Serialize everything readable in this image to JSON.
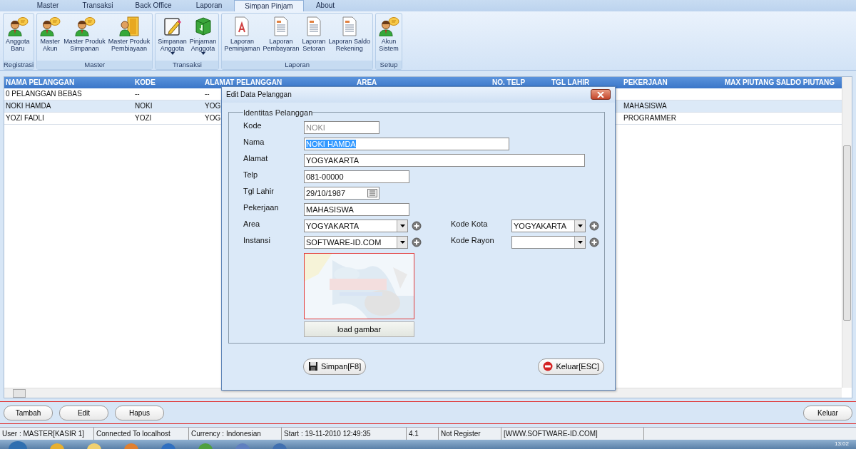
{
  "tabs": [
    {
      "label": "Master",
      "selected": false
    },
    {
      "label": "Transaksi",
      "selected": false
    },
    {
      "label": "Back Office",
      "selected": false
    },
    {
      "label": "Laporan",
      "selected": false
    },
    {
      "label": "Simpan Pinjam",
      "selected": true
    },
    {
      "label": "About",
      "selected": false
    }
  ],
  "ribbon": {
    "groups": [
      {
        "label": "Registrasi",
        "items": [
          {
            "lines": [
              "Anggota",
              "Baru"
            ],
            "dropdown": false
          }
        ]
      },
      {
        "label": "Master",
        "items": [
          {
            "lines": [
              "Master",
              "Akun"
            ],
            "dropdown": false
          },
          {
            "lines": [
              "Master Produk",
              "Simpanan"
            ],
            "dropdown": false
          },
          {
            "lines": [
              "Master Produk",
              "Pembiayaan"
            ],
            "dropdown": false
          }
        ]
      },
      {
        "label": "Transaksi",
        "items": [
          {
            "lines": [
              "Simpanan",
              "Anggota"
            ],
            "dropdown": true
          },
          {
            "lines": [
              "Pinjaman",
              "Anggota"
            ],
            "dropdown": true
          }
        ]
      },
      {
        "label": "Laporan",
        "items": [
          {
            "lines": [
              "Laporan",
              "Peminjaman"
            ],
            "dropdown": false
          },
          {
            "lines": [
              "Laporan",
              "Pembayaran"
            ],
            "dropdown": false
          },
          {
            "lines": [
              "Laporan",
              "Setoran"
            ],
            "dropdown": false
          },
          {
            "lines": [
              "Laporan Saldo",
              "Rekening"
            ],
            "dropdown": false
          }
        ]
      },
      {
        "label": "Setup",
        "items": [
          {
            "lines": [
              "Akun",
              "Sistem"
            ],
            "dropdown": false
          }
        ]
      }
    ]
  },
  "table": {
    "columns": [
      "NAMA PELANGGAN",
      "KODE",
      "ALAMAT PELANGGAN",
      "AREA",
      "NO. TELP",
      "TGL LAHIR",
      "PEKERJAAN",
      "MAX PIUTANG SALDO PIUTANG"
    ],
    "rows": [
      {
        "nama": "0 PELANGGAN BEBAS",
        "kode": "--",
        "alamat": "--",
        "selected": false
      },
      {
        "nama": "NOKI HAMDA",
        "kode": "NOKI",
        "alamat": "YOG",
        "pekerjaan": "MAHASISWA",
        "selected": true
      },
      {
        "nama": "YOZI FADLI",
        "kode": "YOZI",
        "alamat": "YOG",
        "pekerjaan": "PROGRAMMER",
        "selected": false
      }
    ]
  },
  "dialog": {
    "title": "Edit Data Pelanggan",
    "group_label": "Identitas Pelanggan",
    "rows": [
      [
        {
          "label": "Kode",
          "kind": "text",
          "value": "NOKI",
          "disabled": true
        }
      ],
      [
        {
          "label": "Nama",
          "kind": "text",
          "value": "NOKI HAMDA",
          "highlighted": true
        }
      ],
      [
        {
          "label": "Alamat",
          "kind": "text",
          "value": "YOGYAKARTA"
        }
      ],
      [
        {
          "label": "Telp",
          "kind": "text",
          "value": "081-00000"
        }
      ],
      [
        {
          "label": "Tgl Lahir",
          "kind": "date",
          "value": "29/10/1987"
        }
      ],
      [
        {
          "label": "Pekerjaan",
          "kind": "text",
          "value": "MAHASISWA"
        }
      ],
      [
        {
          "label": "Area",
          "kind": "combo",
          "value": "YOGYAKARTA"
        },
        {
          "label": "Kode Kota",
          "kind": "combo",
          "value": "YOGYAKARTA"
        }
      ],
      [
        {
          "label": "Instansi",
          "kind": "combo",
          "value": "SOFTWARE-ID.COM"
        },
        {
          "label": "Kode Rayon",
          "kind": "combo"
        }
      ]
    ],
    "photo": {
      "kind": "picture"
    },
    "load_button": "load gambar",
    "save_button": "Simpan[F8]",
    "exit_button": "Keluar[ESC]"
  },
  "actions": [
    "Tambah",
    "Edit",
    "Hapus"
  ],
  "exit_action": "Keluar",
  "status_bar": [
    "User : MASTER[KASIR 1]",
    "Connected To localhost",
    "Currency : Indonesian",
    "Start  : 19-11-2010 12:49:35",
    "4.1",
    "Not Register",
    "[WWW.SOFTWARE-ID.COM]"
  ],
  "taskbar": {
    "clock": "13:02"
  }
}
